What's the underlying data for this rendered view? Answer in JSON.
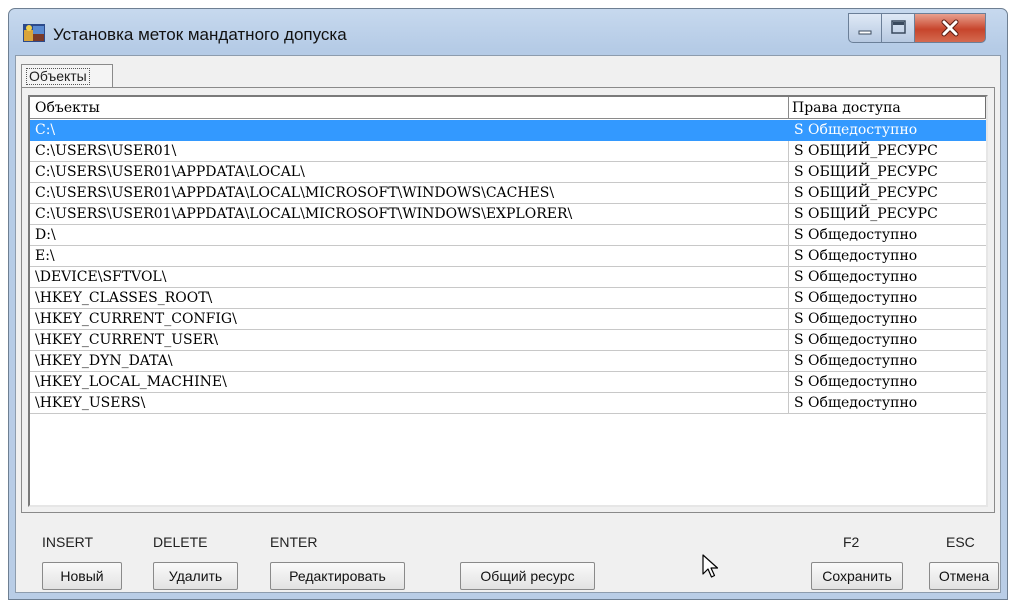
{
  "window": {
    "title": "Установка меток мандатного допуска",
    "icon": "app-icon",
    "controls": [
      "minimize-icon",
      "maximize-icon",
      "close-icon"
    ]
  },
  "tabs": [
    {
      "label": "Объекты",
      "active": true
    }
  ],
  "table": {
    "columns": [
      "Объекты",
      "Права доступа"
    ],
    "selected_row": 0,
    "rows": [
      {
        "object": "C:\\",
        "rights": "S Общедоступно"
      },
      {
        "object": "C:\\USERS\\USER01\\",
        "rights": "S ОБЩИЙ_РЕСУРС"
      },
      {
        "object": "C:\\USERS\\USER01\\APPDATA\\LOCAL\\",
        "rights": "S ОБЩИЙ_РЕСУРС"
      },
      {
        "object": "C:\\USERS\\USER01\\APPDATA\\LOCAL\\MICROSOFT\\WINDOWS\\CACHES\\",
        "rights": "S ОБЩИЙ_РЕСУРС"
      },
      {
        "object": "C:\\USERS\\USER01\\APPDATA\\LOCAL\\MICROSOFT\\WINDOWS\\EXPLORER\\",
        "rights": "S ОБЩИЙ_РЕСУРС"
      },
      {
        "object": "D:\\",
        "rights": "S Общедоступно"
      },
      {
        "object": "E:\\",
        "rights": "S Общедоступно"
      },
      {
        "object": "\\DEVICE\\SFTVOL\\",
        "rights": "S Общедоступно"
      },
      {
        "object": "\\HKEY_CLASSES_ROOT\\",
        "rights": "S Общедоступно"
      },
      {
        "object": "\\HKEY_CURRENT_CONFIG\\",
        "rights": "S Общедоступно"
      },
      {
        "object": "\\HKEY_CURRENT_USER\\",
        "rights": "S Общедоступно"
      },
      {
        "object": "\\HKEY_DYN_DATA\\",
        "rights": "S Общедоступно"
      },
      {
        "object": "\\HKEY_LOCAL_MACHINE\\",
        "rights": "S Общедоступно"
      },
      {
        "object": "\\HKEY_USERS\\",
        "rights": "S Общедоступно"
      }
    ]
  },
  "hotkeys": {
    "insert": "INSERT",
    "delete": "DELETE",
    "enter": "ENTER",
    "f2": "F2",
    "esc": "ESC"
  },
  "buttons": {
    "new": "Новый",
    "delete": "Удалить",
    "edit": "Редактировать",
    "shared_resource": "Общий ресурс",
    "save": "Сохранить",
    "cancel": "Отмена"
  },
  "colors": {
    "selection": "#3399ff",
    "close_button": "#c7452c"
  }
}
